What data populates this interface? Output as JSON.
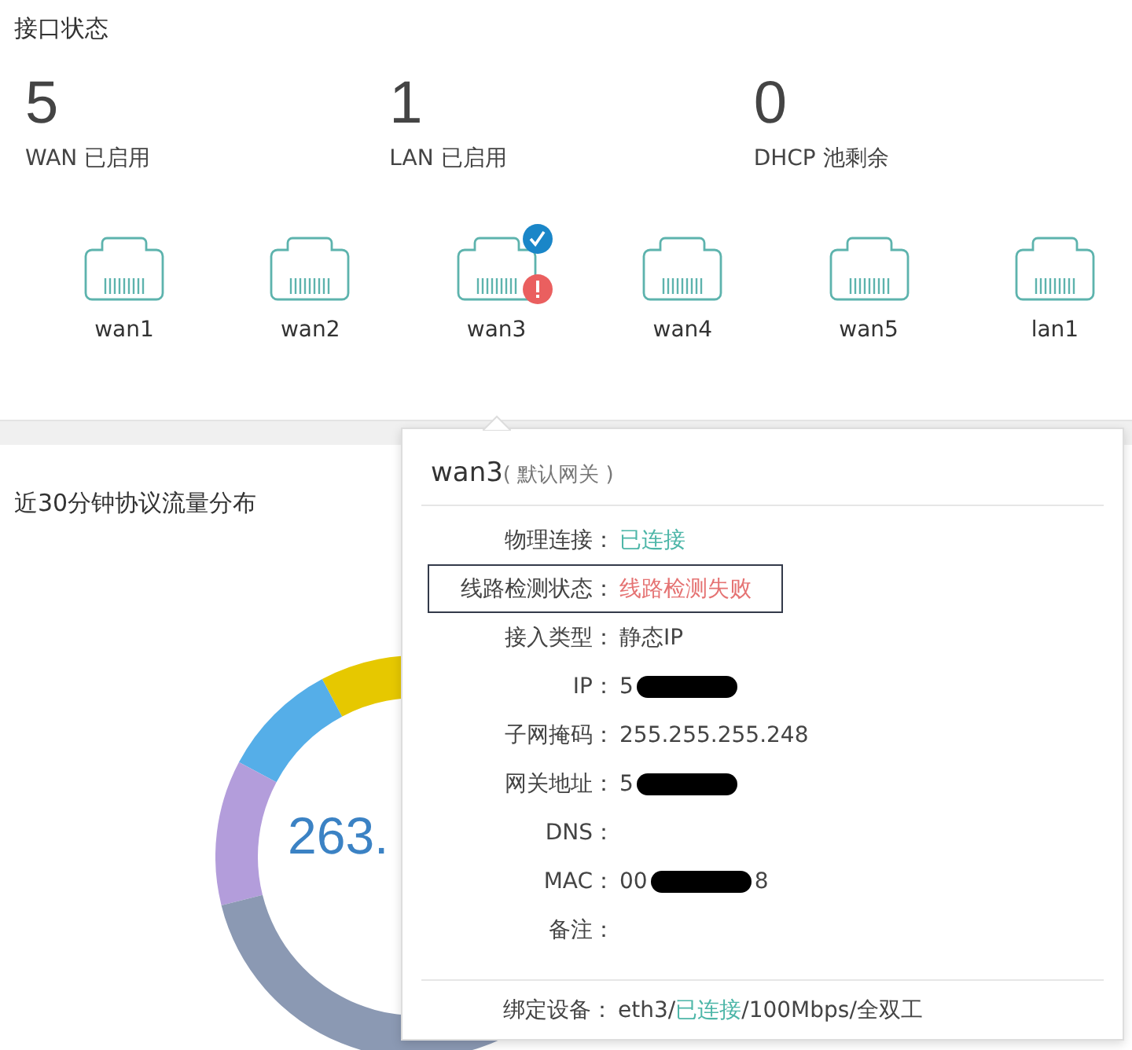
{
  "interface_status": {
    "title": "接口状态",
    "stats": [
      {
        "value": "5",
        "label": "WAN 已启用"
      },
      {
        "value": "1",
        "label": "LAN 已启用"
      },
      {
        "value": "0",
        "label": "DHCP 池剩余"
      }
    ],
    "ports": [
      {
        "name": "wan1",
        "connected": false,
        "alert": false
      },
      {
        "name": "wan2",
        "connected": false,
        "alert": false
      },
      {
        "name": "wan3",
        "connected": true,
        "alert": true
      },
      {
        "name": "wan4",
        "connected": false,
        "alert": false
      },
      {
        "name": "wan5",
        "connected": false,
        "alert": false
      },
      {
        "name": "lan1",
        "connected": false,
        "alert": false
      }
    ]
  },
  "traffic": {
    "title": "近30分钟协议流量分布",
    "total": "263."
  },
  "popup": {
    "title": "wan3",
    "subtitle": "( 默认网关 )",
    "rows": [
      {
        "label": "物理连接：",
        "value": "已连接",
        "kind": "good",
        "boxed": false
      },
      {
        "label": "线路检测状态：",
        "value": "线路检测失败",
        "kind": "bad",
        "boxed": true
      },
      {
        "label": "接入类型：",
        "value": "静态IP",
        "kind": "plain",
        "boxed": false
      },
      {
        "label": "IP：",
        "value": "5",
        "kind": "redacted",
        "boxed": false
      },
      {
        "label": "子网掩码：",
        "value": "255.255.255.248",
        "kind": "plain",
        "boxed": false
      },
      {
        "label": "网关地址：",
        "value": "5",
        "kind": "redacted",
        "boxed": false
      },
      {
        "label": "DNS：",
        "kind": "plain",
        "boxed": false
      },
      {
        "label": "MAC：",
        "value": "00",
        "value_end": "8",
        "kind": "redacted",
        "boxed": false
      },
      {
        "label": "备注：",
        "kind": "plain",
        "boxed": false
      }
    ],
    "footer": {
      "label": "绑定设备：",
      "parts": [
        {
          "text": "eth3/",
          "kind": "plain"
        },
        {
          "text": "已连接",
          "kind": "good"
        },
        {
          "text": "/100Mbps/全双工",
          "kind": "plain"
        }
      ]
    }
  }
}
